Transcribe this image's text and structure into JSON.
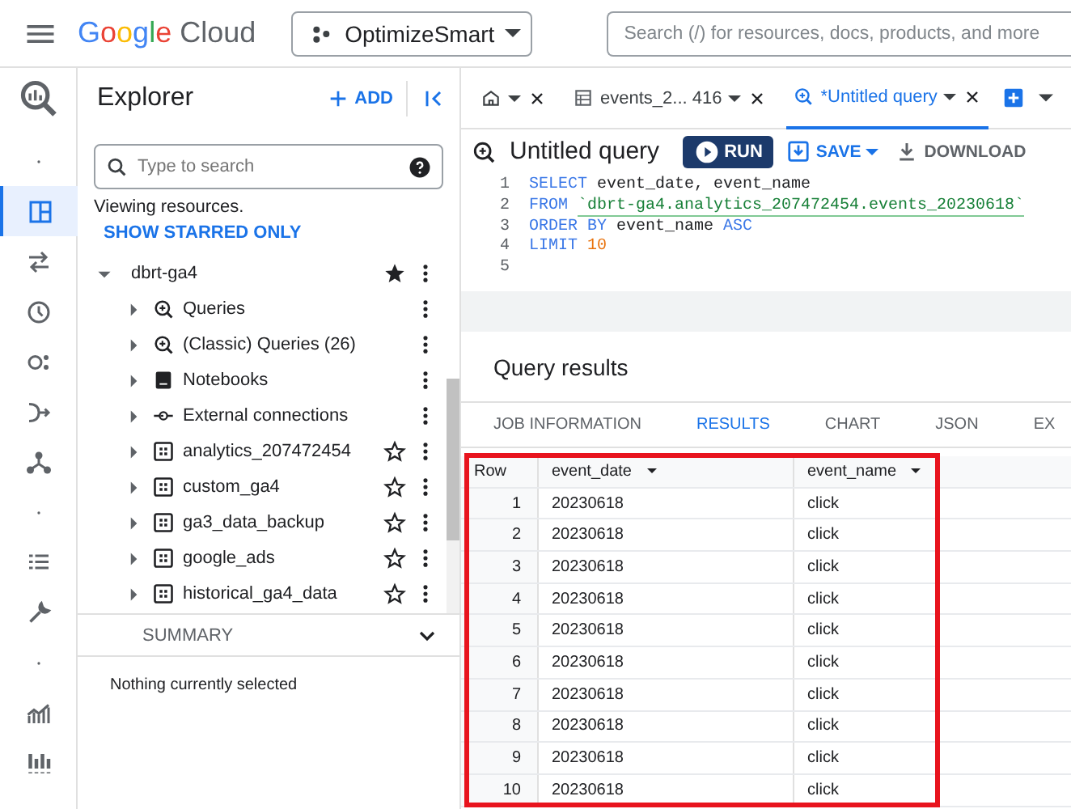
{
  "topbar": {
    "logo_word": "Google",
    "logo_suffix": "Cloud",
    "project": "OptimizeSmart",
    "search": {
      "placeholder": "Search (/) for resources, docs, products, and more"
    }
  },
  "rail": [
    {
      "kind": "dot",
      "selected": false
    },
    {
      "kind": "grid",
      "selected": true
    },
    {
      "kind": "arrows",
      "selected": false
    },
    {
      "kind": "clock",
      "selected": false
    },
    {
      "kind": "nodes",
      "selected": false
    },
    {
      "kind": "pipe",
      "selected": false
    },
    {
      "kind": "tree",
      "selected": false
    },
    {
      "kind": "dot",
      "selected": false
    },
    {
      "kind": "list",
      "selected": false
    },
    {
      "kind": "wrench",
      "selected": false
    },
    {
      "kind": "dot",
      "selected": false
    },
    {
      "kind": "chart",
      "selected": false
    },
    {
      "kind": "bars",
      "selected": false
    }
  ],
  "explorer": {
    "title": "Explorer",
    "add": "ADD",
    "search": {
      "placeholder": "Type to search"
    },
    "viewing": "Viewing resources.",
    "starred_link": "SHOW STARRED ONLY",
    "tree": [
      {
        "label": "dbrt-ga4",
        "expanded": true,
        "starred": true,
        "children": [
          {
            "label": "Queries",
            "kind": "query",
            "expanded": false
          },
          {
            "label": "(Classic) Queries (26)",
            "kind": "query",
            "expanded": false
          },
          {
            "label": "Notebooks",
            "kind": "notebook",
            "expanded": false
          },
          {
            "label": "External connections",
            "kind": "connection",
            "expanded": false
          },
          {
            "label": "analytics_207472454",
            "kind": "dataset",
            "expanded": false,
            "starred": false
          },
          {
            "label": "custom_ga4",
            "kind": "dataset",
            "expanded": false,
            "starred": false
          },
          {
            "label": "ga3_data_backup",
            "kind": "dataset",
            "expanded": false,
            "starred": false
          },
          {
            "label": "google_ads",
            "kind": "dataset",
            "expanded": false,
            "starred": false
          },
          {
            "label": "historical_ga4_data",
            "kind": "dataset",
            "expanded": false,
            "starred": false
          }
        ]
      }
    ],
    "summary": {
      "title": "SUMMARY",
      "expanded": false,
      "text": "Nothing currently selected"
    }
  },
  "tabs": [
    {
      "kind": "home",
      "selected": false
    },
    {
      "kind": "table",
      "label": "events_2... 416",
      "selected": false
    },
    {
      "kind": "query",
      "label": "*Untitled query",
      "selected": true
    }
  ],
  "query": {
    "title": "Untitled query",
    "run": "RUN",
    "save": "SAVE",
    "download": "DOWNLOAD",
    "lines": [
      {
        "number": "1",
        "tokens": [
          {
            "kind": "keyword",
            "text": "SELECT"
          },
          {
            "kind": "ident",
            "text": " event_date, event_name"
          }
        ]
      },
      {
        "number": "2",
        "tokens": [
          {
            "kind": "keyword",
            "text": "FROM "
          },
          {
            "kind": "string",
            "text": "`dbrt-ga4.analytics_207472454.events_20230618`"
          }
        ]
      },
      {
        "number": "3",
        "tokens": [
          {
            "kind": "keyword",
            "text": "ORDER BY"
          },
          {
            "kind": "ident",
            "text": " event_name "
          },
          {
            "kind": "keyword",
            "text": "ASC"
          }
        ]
      },
      {
        "number": "4",
        "tokens": [
          {
            "kind": "keyword",
            "text": "LIMIT "
          },
          {
            "kind": "number",
            "text": "10"
          }
        ]
      },
      {
        "number": "5"
      }
    ]
  },
  "results": {
    "title": "Query results",
    "tabs": [
      {
        "label": "JOB INFORMATION",
        "selected": false
      },
      {
        "label": "RESULTS",
        "selected": true
      },
      {
        "label": "CHART",
        "selected": false
      },
      {
        "label": "JSON",
        "selected": false
      },
      {
        "label": "EX",
        "selected": false
      }
    ],
    "table": {
      "highlighted": true,
      "columns": [
        "Row",
        "event_date",
        "event_name"
      ],
      "rows": [
        [
          "1",
          "20230618",
          "click"
        ],
        [
          "2",
          "20230618",
          "click"
        ],
        [
          "3",
          "20230618",
          "click"
        ],
        [
          "4",
          "20230618",
          "click"
        ],
        [
          "5",
          "20230618",
          "click"
        ],
        [
          "6",
          "20230618",
          "click"
        ],
        [
          "7",
          "20230618",
          "click"
        ],
        [
          "8",
          "20230618",
          "click"
        ],
        [
          "9",
          "20230618",
          "click"
        ],
        [
          "10",
          "20230618",
          "click"
        ]
      ]
    }
  }
}
